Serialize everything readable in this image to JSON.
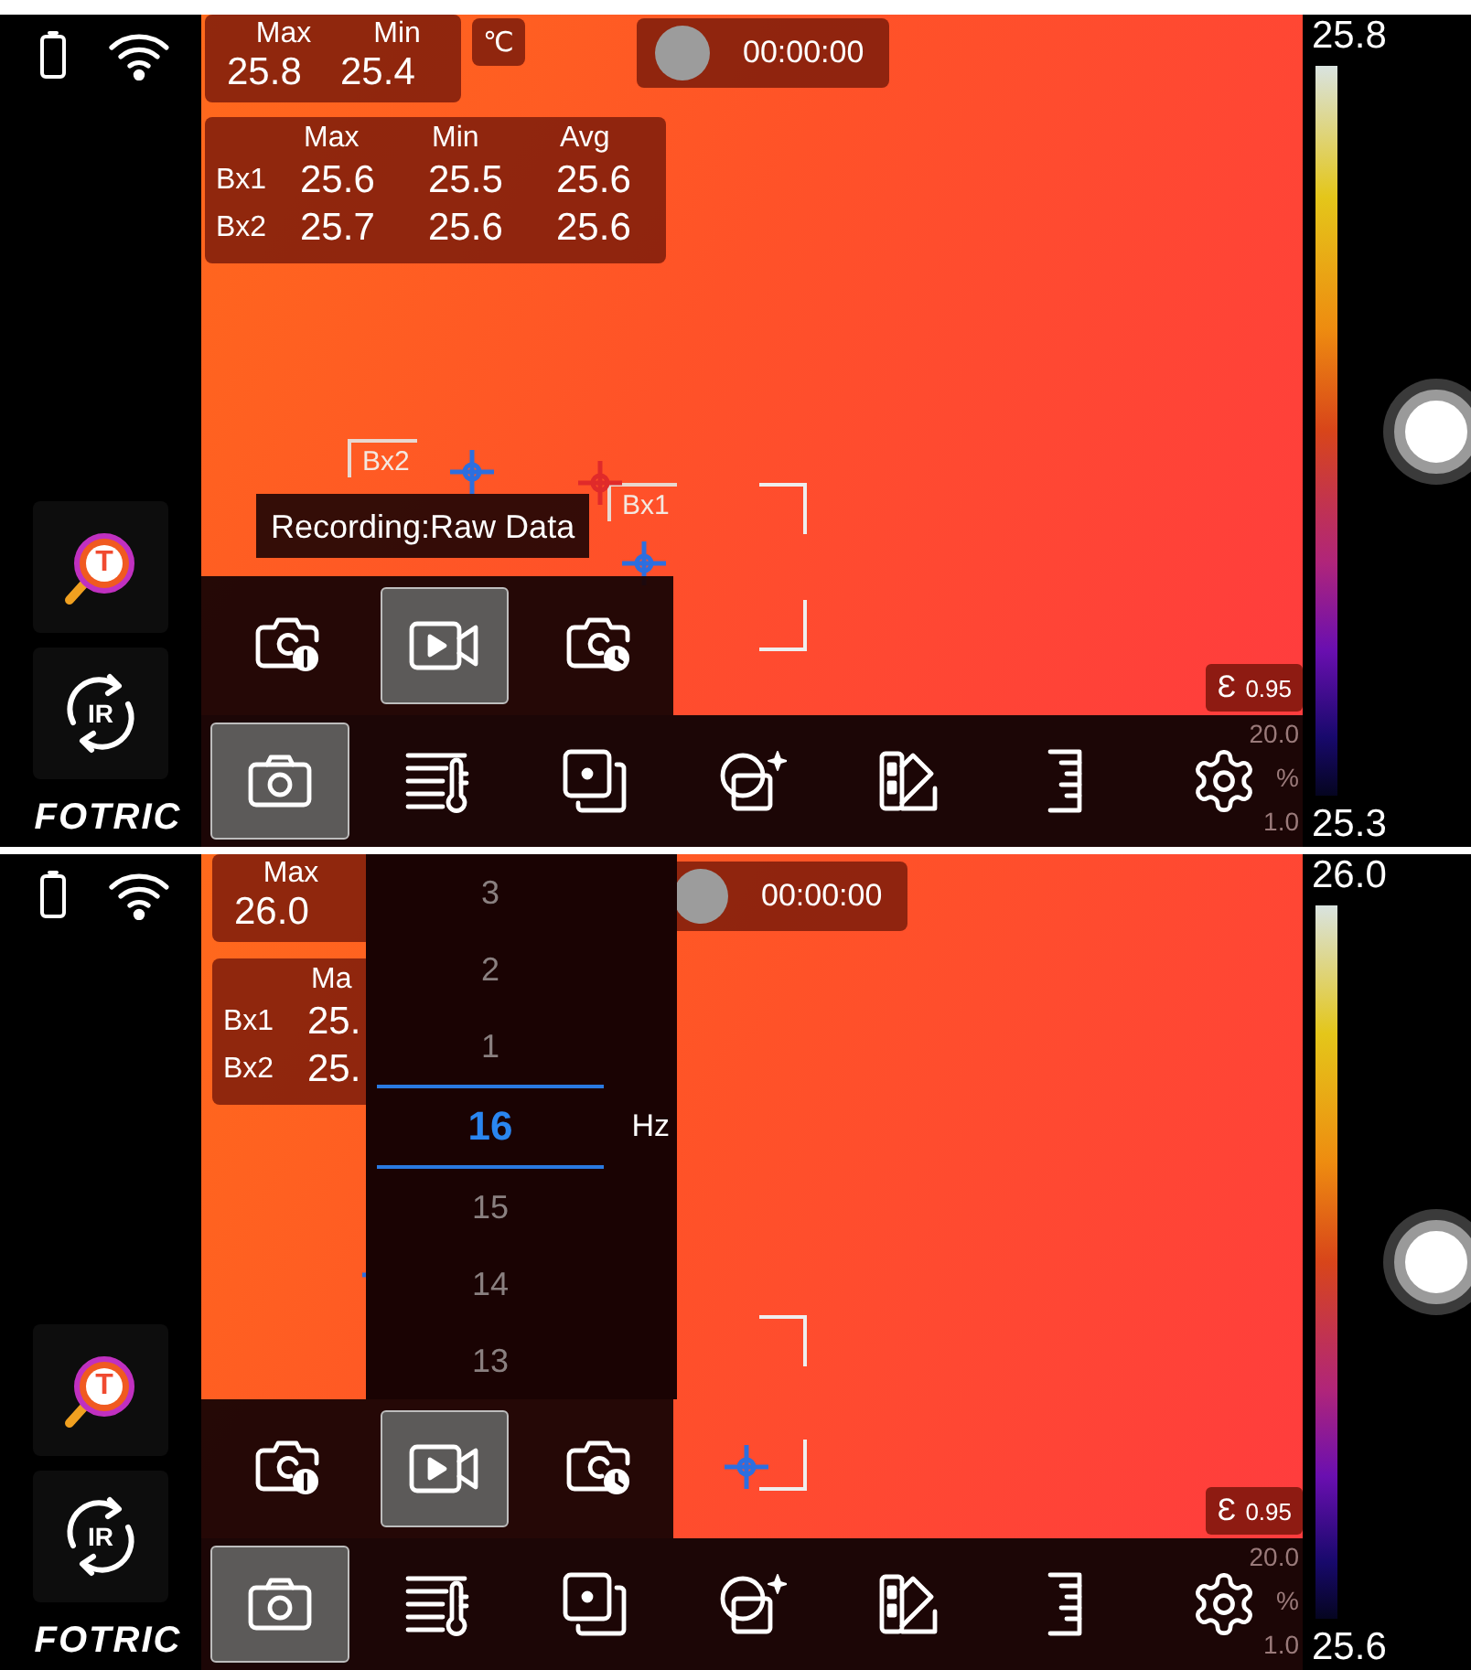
{
  "screens": [
    {
      "left_tools": [
        {
          "kind": "thermal-search",
          "glyph": "T"
        },
        {
          "kind": "ir-rotate",
          "glyph": "IR"
        }
      ],
      "brand": "FOTRIC",
      "spot": {
        "headers": [
          "Max",
          "Min"
        ],
        "values": [
          "25.8",
          "25.4"
        ]
      },
      "unit": "℃",
      "record_time": "00:00:00",
      "box_table": {
        "columns": [
          "Max",
          "Min",
          "Avg"
        ],
        "rows": [
          {
            "label": "Bx1",
            "values": [
              "25.6",
              "25.5",
              "25.6"
            ]
          },
          {
            "label": "Bx2",
            "values": [
              "25.7",
              "25.6",
              "25.6"
            ]
          }
        ]
      },
      "box_labels": [
        "Bx2",
        "Bx1"
      ],
      "toast": "Recording:Raw Data",
      "capture_modes": [
        {
          "kind": "photo-single",
          "selected": false
        },
        {
          "kind": "video",
          "selected": true
        },
        {
          "kind": "photo-timer",
          "selected": false
        }
      ],
      "emissivity": {
        "symbol": "Ɛ",
        "value": "0.95"
      },
      "env_params": [
        "20.0",
        "%",
        "1.0"
      ],
      "toolbar": [
        {
          "kind": "camera",
          "selected": true
        },
        {
          "kind": "thermo-list",
          "selected": false
        },
        {
          "kind": "layers",
          "selected": false
        },
        {
          "kind": "shape-add",
          "selected": false
        },
        {
          "kind": "palette",
          "selected": false
        },
        {
          "kind": "ruler",
          "selected": false
        },
        {
          "kind": "settings",
          "selected": false
        }
      ],
      "scale_max": "25.8",
      "scale_min": "25.3"
    },
    {
      "left_tools": [
        {
          "kind": "thermal-search",
          "glyph": "T"
        },
        {
          "kind": "ir-rotate",
          "glyph": "IR"
        }
      ],
      "brand": "FOTRIC",
      "spot": {
        "headers": [
          "Max"
        ],
        "values": [
          "26.0"
        ]
      },
      "record_time": "00:00:00",
      "box_table": {
        "columns": [
          "Ma"
        ],
        "rows": [
          {
            "label": "Bx1",
            "values": [
              "25."
            ]
          },
          {
            "label": "Bx2",
            "values": [
              "25."
            ]
          }
        ]
      },
      "frame_rate_picker": {
        "unit": "Hz",
        "options": [
          {
            "label": "3",
            "selected": false
          },
          {
            "label": "2",
            "selected": false
          },
          {
            "label": "1",
            "selected": false
          },
          {
            "label": "16",
            "selected": true
          },
          {
            "label": "15",
            "selected": false
          },
          {
            "label": "14",
            "selected": false
          },
          {
            "label": "13",
            "selected": false
          }
        ]
      },
      "capture_modes": [
        {
          "kind": "photo-single",
          "selected": false
        },
        {
          "kind": "video",
          "selected": true
        },
        {
          "kind": "photo-timer",
          "selected": false
        }
      ],
      "emissivity": {
        "symbol": "Ɛ",
        "value": "0.95"
      },
      "env_params": [
        "20.0",
        "%",
        "1.0"
      ],
      "toolbar": [
        {
          "kind": "camera",
          "selected": true
        },
        {
          "kind": "thermo-list",
          "selected": false
        },
        {
          "kind": "layers",
          "selected": false
        },
        {
          "kind": "shape-add",
          "selected": false
        },
        {
          "kind": "palette",
          "selected": false
        },
        {
          "kind": "ruler",
          "selected": false
        },
        {
          "kind": "settings",
          "selected": false
        }
      ],
      "scale_max": "26.0",
      "scale_min": "25.6"
    }
  ]
}
